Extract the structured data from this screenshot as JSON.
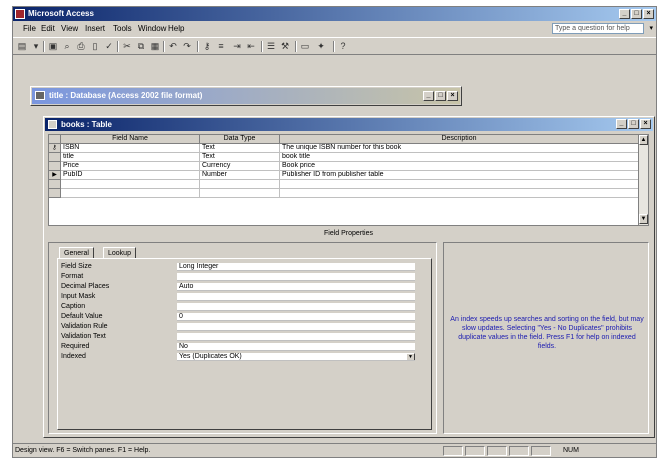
{
  "app": {
    "title": "Microsoft Access"
  },
  "menu": [
    "File",
    "Edit",
    "View",
    "Insert",
    "Tools",
    "Window",
    "Help"
  ],
  "ask_question": {
    "placeholder": "Type a question for help"
  },
  "db_window": {
    "title": "title : Database (Access 2002 file format)"
  },
  "table_window": {
    "title": "books : Table",
    "headers": {
      "field_name": "Field Name",
      "data_type": "Data Type",
      "description": "Description"
    },
    "rows": [
      {
        "field": "ISBN",
        "type": "Text",
        "desc": "The unique ISBN number for this book",
        "key": true,
        "current": false
      },
      {
        "field": "title",
        "type": "Text",
        "desc": "book title",
        "key": false,
        "current": false
      },
      {
        "field": "Price",
        "type": "Currency",
        "desc": "Book price",
        "key": false,
        "current": false
      },
      {
        "field": "PubID",
        "type": "Number",
        "desc": "Publisher ID from publisher table",
        "key": false,
        "current": true
      }
    ],
    "field_properties_label": "Field Properties"
  },
  "properties": {
    "tabs": [
      "General",
      "Lookup"
    ],
    "rows": [
      {
        "label": "Field Size",
        "value": "Long Integer"
      },
      {
        "label": "Format",
        "value": ""
      },
      {
        "label": "Decimal Places",
        "value": "Auto"
      },
      {
        "label": "Input Mask",
        "value": ""
      },
      {
        "label": "Caption",
        "value": ""
      },
      {
        "label": "Default Value",
        "value": "0"
      },
      {
        "label": "Validation Rule",
        "value": ""
      },
      {
        "label": "Validation Text",
        "value": ""
      },
      {
        "label": "Required",
        "value": "No"
      },
      {
        "label": "Indexed",
        "value": "Yes (Duplicates OK)"
      }
    ],
    "help_text": "An index speeds up searches and sorting on the field, but may slow updates. Selecting \"Yes - No Duplicates\" prohibits duplicate values in the field. Press F1 for help on indexed fields."
  },
  "status": {
    "text": "Design view. F6 = Switch panes. F1 = Help.",
    "num": "NUM"
  }
}
